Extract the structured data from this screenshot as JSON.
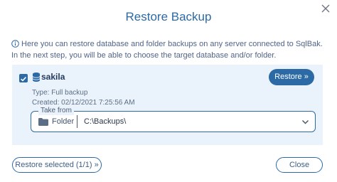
{
  "dialog": {
    "title": "Restore Backup",
    "close_icon": "close-icon"
  },
  "info": {
    "icon": "info-icon",
    "text": "Here you can restore database and folder backups on any server connected to SqlBak. In the next step, you will be able to choose the target database and/or folder."
  },
  "item": {
    "checked": true,
    "db_icon": "database-icon",
    "name": "sakila",
    "restore_label": "Restore »",
    "type_line": "Type:  Full backup",
    "created_line": "Created:  02/12/2021 7:25:56 AM",
    "take_from": {
      "legend": "Take from",
      "source_icon": "folder-icon",
      "source_label": "Folder",
      "path": "C:\\Backups\\"
    }
  },
  "footer": {
    "restore_selected_label": "Restore selected (1/1) »",
    "close_label": "Close"
  },
  "colors": {
    "accent": "#2c6aa6",
    "panel_background": "#eaf3fb"
  }
}
